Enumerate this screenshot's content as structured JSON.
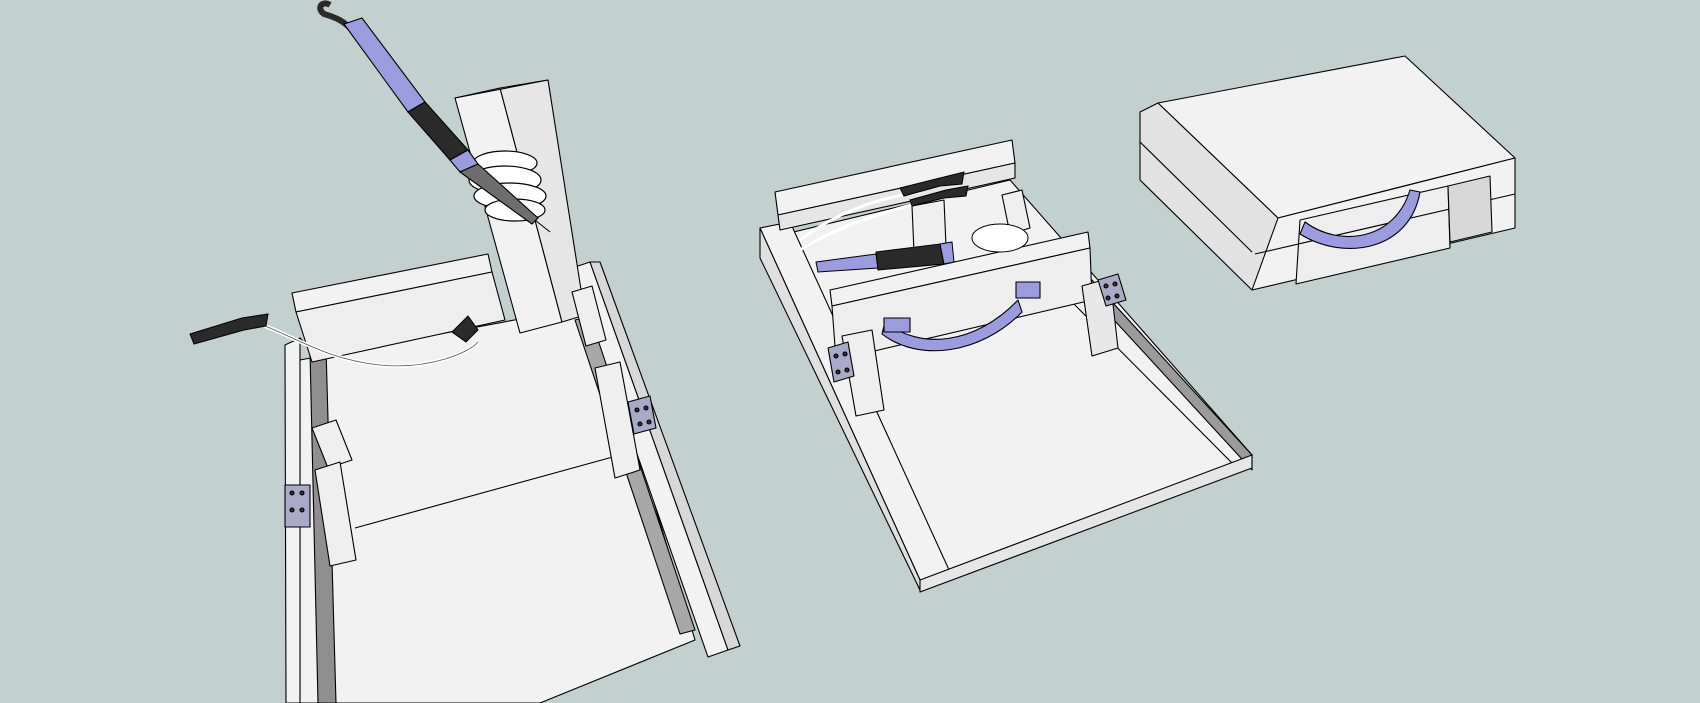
{
  "scene": {
    "background": "#c2d0d0",
    "colors": {
      "panel_light": "#f2f2f2",
      "panel_mid": "#e4e4e4",
      "panel_shadow": "#a0a0a0",
      "outline": "#000000",
      "accent": "#9b9be0",
      "accent_dark": "#7070b8",
      "iron_black": "#2a2a2a",
      "iron_grey": "#6e6e6e",
      "coil": "#ffffff",
      "hinge": "#a8aac8"
    },
    "models": [
      {
        "id": "open-station",
        "parts": [
          "base-tray",
          "back-upright",
          "holder-coil",
          "soldering-iron",
          "clip-cable",
          "alligator-clip",
          "hinge-left",
          "hinge-right"
        ]
      },
      {
        "id": "folded-station",
        "parts": [
          "tray",
          "inner-wall",
          "handle",
          "stored-iron",
          "stored-clips",
          "hinge-left",
          "hinge-right"
        ]
      },
      {
        "id": "closed-case",
        "parts": [
          "case-body",
          "lid",
          "handle"
        ]
      }
    ]
  }
}
